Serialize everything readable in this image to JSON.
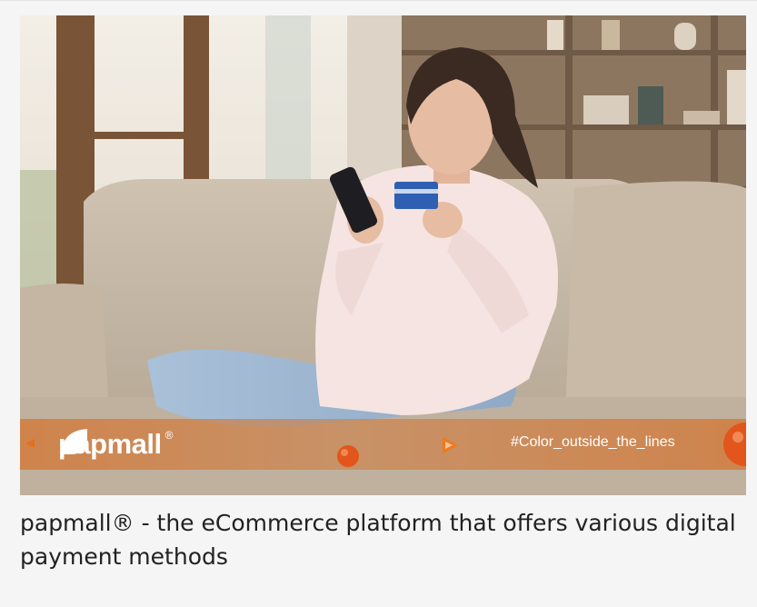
{
  "banner": {
    "brand_name": "papmall",
    "brand_mark": "®",
    "hashtag": "#Color_outside_the_lines"
  },
  "caption": {
    "text": "papmall® - the eCommerce platform that offers various digital payment methods"
  },
  "icons": {
    "logo": "papmall-leaf-logo",
    "left_arrow": "small-orange-triangle-icon",
    "play": "play-triangle-icon"
  },
  "colors": {
    "accent": "#e2701f",
    "banner": "#d6722c",
    "caption_text": "#222222"
  }
}
